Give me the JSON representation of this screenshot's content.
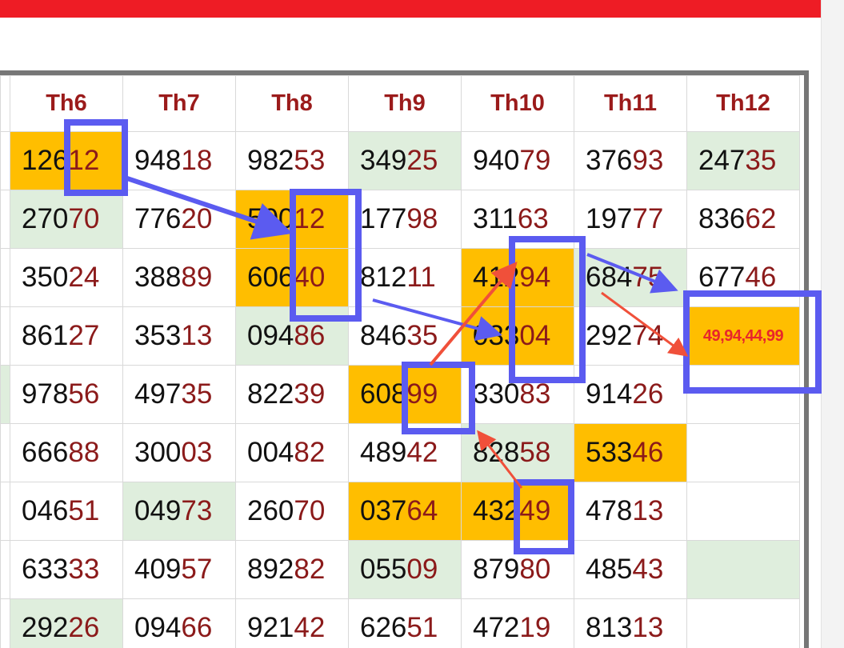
{
  "headers": [
    "Th6",
    "Th7",
    "Th8",
    "Th9",
    "Th10",
    "Th11",
    "Th12"
  ],
  "rows": [
    [
      "12612",
      "94818",
      "98253",
      "34925",
      "94079",
      "37693",
      "24735"
    ],
    [
      "27070",
      "77620",
      "50012",
      "17798",
      "31163",
      "19777",
      "83662"
    ],
    [
      "35024",
      "38889",
      "60640",
      "81211",
      "41294",
      "68475",
      "67746"
    ],
    [
      "86127",
      "35313",
      "09486",
      "84635",
      "03304",
      "29274",
      "49,94,44,99"
    ],
    [
      "97856",
      "49735",
      "82239",
      "60899",
      "33083",
      "91426",
      ""
    ],
    [
      "66688",
      "30003",
      "00482",
      "48942",
      "82858",
      "53346",
      ""
    ],
    [
      "04651",
      "04973",
      "26070",
      "03764",
      "43249",
      "47813",
      ""
    ],
    [
      "63333",
      "40957",
      "89282",
      "05509",
      "87980",
      "48543",
      ""
    ],
    [
      "29226",
      "09466",
      "92142",
      "62651",
      "47219",
      "81313",
      ""
    ]
  ],
  "colors": {
    "header_bar": "#ee1c25",
    "header_text": "#9b1b1b",
    "last_two_digits": "#8b1a1a",
    "highlight_cell": "#ffbe00",
    "pale_green_cell": "#dfeedd",
    "prediction_text": "#e8262b",
    "annotation_box": "#5b5bf0",
    "annotation_arrow_red": "#f0503a"
  }
}
